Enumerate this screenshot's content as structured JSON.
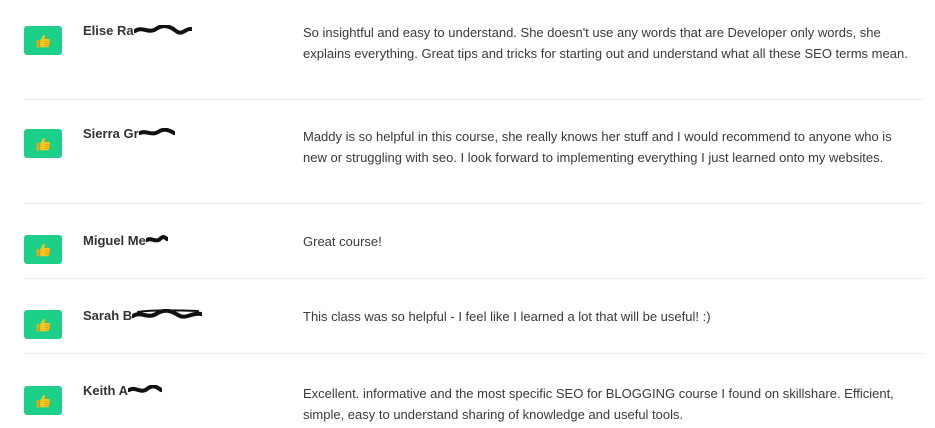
{
  "reviews": [
    {
      "name": "Elise Ra",
      "comment": "So insightful and easy to understand. She doesn't use any words that are Developer only words, she explains everything. Great tips and tricks for starting out and understand what all these SEO terms mean.",
      "rating_icon": "thumbs-up-icon"
    },
    {
      "name": "Sierra Gr",
      "comment": "Maddy is so helpful in this course, she really knows her stuff and I would recommend to anyone who is new or struggling with seo. I look forward to implementing everything I just learned onto my websites.",
      "rating_icon": "thumbs-up-icon"
    },
    {
      "name": "Miguel Me",
      "comment": "Great course!",
      "rating_icon": "thumbs-up-icon"
    },
    {
      "name": "Sarah B",
      "comment": "This class was so helpful - I feel like I learned a lot that will be useful! :)",
      "rating_icon": "thumbs-up-icon"
    },
    {
      "name": "Keith A",
      "comment": "Excellent. informative and the most specific SEO for BLOGGING course I found on skillshare. Efficient, simple, easy to understand sharing of knowledge and useful tools.",
      "rating_icon": "thumbs-up-icon"
    }
  ],
  "colors": {
    "thumb_badge": "#1dd08a",
    "thumb_icon": "#f5c518",
    "divider": "#ececec",
    "text": "#3a3a3a"
  }
}
